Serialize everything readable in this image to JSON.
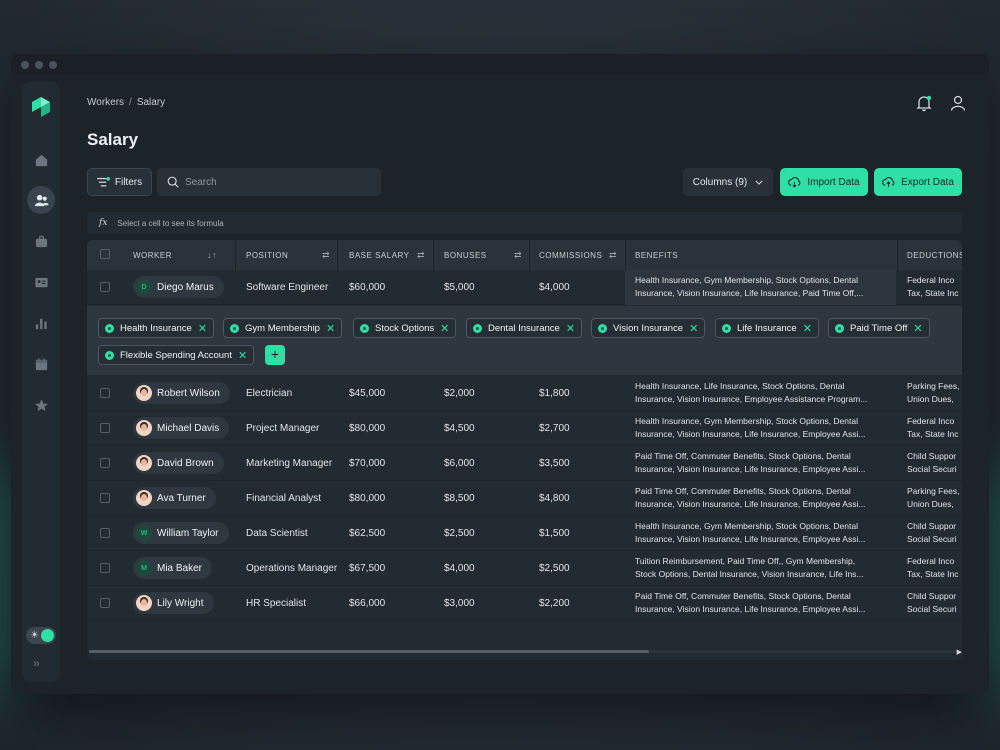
{
  "breadcrumb": {
    "root": "Workers",
    "separator": "/",
    "current": "Salary"
  },
  "page_title": "Salary",
  "toolbar": {
    "filters_label": "Filters",
    "search_placeholder": "Search",
    "columns_label": "Columns (9)",
    "import_label": "Import Data",
    "export_label": "Export Data"
  },
  "formula_bar": {
    "icon": "fx",
    "hint": "Select a cell to see its formula"
  },
  "columns": {
    "worker": "WORKER",
    "position": "POSITION",
    "base_salary": "BASE SALARY",
    "bonuses": "BONUSES",
    "commissions": "COMMISSIONS",
    "benefits": "BENEFITS",
    "deductions": "DEDUCTIONS"
  },
  "rows": [
    {
      "name": "Diego Marus",
      "initial": "D",
      "position": "Software Engineer",
      "salary": "$60,000",
      "bonus": "$5,000",
      "commission": "$4,000",
      "benefits1": "Health Insurance, Gym Membership, Stock Options, Dental",
      "benefits2": "Insurance, Vision Insurance, Life Insurance, Paid Time Off,...",
      "deduct1": "Federal Inco",
      "deduct2": "Tax, State Inc"
    },
    {
      "name": "Robert Wilson",
      "initial": "",
      "position": "Electrician",
      "salary": "$45,000",
      "bonus": "$2,000",
      "commission": "$1,800",
      "benefits1": "Health Insurance, Life Insurance, Stock Options, Dental",
      "benefits2": "Insurance, Vision Insurance, Employee Assistance Program...",
      "deduct1": "Parking Fees,",
      "deduct2": "Union Dues,"
    },
    {
      "name": "Michael Davis",
      "initial": "",
      "position": "Project Manager",
      "salary": "$80,000",
      "bonus": "$4,500",
      "commission": "$2,700",
      "benefits1": "Health Insurance, Gym Membership, Stock Options, Dental",
      "benefits2": "Insurance, Vision Insurance, Life Insurance, Employee Assi...",
      "deduct1": "Federal Inco",
      "deduct2": "Tax, State Inc"
    },
    {
      "name": "David Brown",
      "initial": "",
      "position": "Marketing Manager",
      "salary": "$70,000",
      "bonus": "$6,000",
      "commission": "$3,500",
      "benefits1": "Paid Time Off, Commuter Benefits, Stock Options, Dental",
      "benefits2": "Insurance, Vision Insurance, Life Insurance, Employee Assi...",
      "deduct1": "Child Suppor",
      "deduct2": "Social Securi"
    },
    {
      "name": "Ava Turner",
      "initial": "",
      "position": "Financial Analyst",
      "salary": "$80,000",
      "bonus": "$8,500",
      "commission": "$4,800",
      "benefits1": "Paid Time Off, Commuter Benefits, Stock Options, Dental",
      "benefits2": "Insurance, Vision Insurance, Life Insurance, Employee Assi...",
      "deduct1": "Parking Fees,",
      "deduct2": "Union Dues,"
    },
    {
      "name": "William Taylor",
      "initial": "W",
      "position": "Data Scientist",
      "salary": "$62,500",
      "bonus": "$2,500",
      "commission": "$1,500",
      "benefits1": "Health Insurance, Gym Membership, Stock Options, Dental",
      "benefits2": "Insurance, Vision Insurance, Life Insurance, Employee Assi...",
      "deduct1": "Child Suppor",
      "deduct2": "Social Securi"
    },
    {
      "name": "Mia Baker",
      "initial": "M",
      "position": "Operations Manager",
      "salary": "$67,500",
      "bonus": "$4,000",
      "commission": "$2,500",
      "benefits1": "Tuition Reimbursement, Paid Time Off,, Gym Membership,",
      "benefits2": "Stock Options, Dental Insurance, Vision Insurance, Life Ins...",
      "deduct1": "Federal Inco",
      "deduct2": "Tax, State Inc"
    },
    {
      "name": "Lily Wright",
      "initial": "",
      "position": "HR Specialist",
      "salary": "$66,000",
      "bonus": "$3,000",
      "commission": "$2,200",
      "benefits1": "Paid Time Off, Commuter Benefits, Stock Options, Dental",
      "benefits2": "Insurance, Vision Insurance, Life Insurance, Employee Assi...",
      "deduct1": "Child Suppor",
      "deduct2": "Social Securi"
    }
  ],
  "benefit_tags": [
    "Health Insurance",
    "Gym Membership",
    "Stock Options",
    "Dental Insurance",
    "Vision Insurance",
    "Life Insurance",
    "Paid Time Off",
    "Flexible Spending Account"
  ],
  "add_tag_label": "+",
  "sidebar_icons": [
    "logo-icon",
    "home-icon",
    "users-icon",
    "briefcase-icon",
    "id-card-icon",
    "bar-chart-icon",
    "calendar-icon",
    "star-icon"
  ],
  "colors": {
    "accent": "#2ee0a6",
    "background": "#1c2329",
    "panel": "#232b32"
  }
}
